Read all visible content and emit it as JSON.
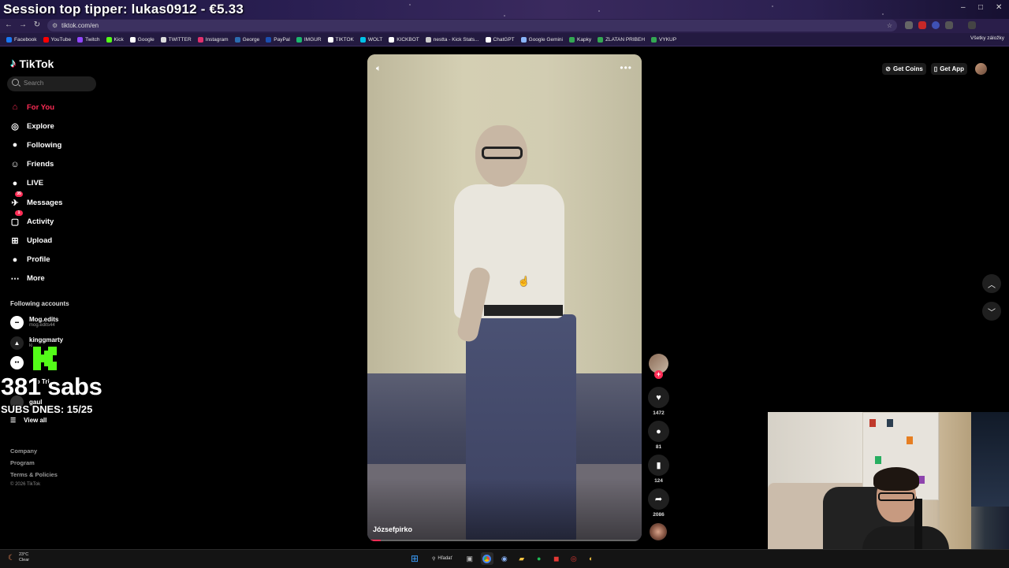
{
  "overlay": {
    "session_tipper": "Session top tipper: lukas0912 - €5.33",
    "subs_count": "381 sabs",
    "subs_goal": "SUBS DNES: 15/25"
  },
  "browser": {
    "url": "tiktok.com/en",
    "window_controls": [
      "–",
      "□",
      "✕"
    ],
    "bookmarks": [
      {
        "label": "Facebook",
        "color": "#1877f2"
      },
      {
        "label": "YouTube",
        "color": "#ff0000"
      },
      {
        "label": "Twitch",
        "color": "#9146ff"
      },
      {
        "label": "Kick",
        "color": "#53fc18"
      },
      {
        "label": "Google",
        "color": "#ffffff"
      },
      {
        "label": "TWITTER",
        "color": "#dddddd"
      },
      {
        "label": "Instagram",
        "color": "#e1306c"
      },
      {
        "label": "George",
        "color": "#2b6cb0"
      },
      {
        "label": "PayPal",
        "color": "#1b4fb0"
      },
      {
        "label": "IMGUR",
        "color": "#1bb76e"
      },
      {
        "label": "TIKTOK",
        "color": "#ffffff"
      },
      {
        "label": "WOLT",
        "color": "#00c2e8"
      },
      {
        "label": "KICKBOT",
        "color": "#ffffff"
      },
      {
        "label": "nestta - Kick Stats...",
        "color": "#cccccc"
      },
      {
        "label": "ChatGPT",
        "color": "#ffffff"
      },
      {
        "label": "Google Gemini",
        "color": "#8ab4f8"
      },
      {
        "label": "Kapky",
        "color": "#34a853"
      },
      {
        "label": "ZLATAN PRIBEH",
        "color": "#34a853"
      },
      {
        "label": "VYKUP",
        "color": "#34a853"
      }
    ],
    "other_bookmarks": "Všetky záložky"
  },
  "sidebar": {
    "logo": "TikTok",
    "search_placeholder": "Search",
    "nav": [
      {
        "label": "For You",
        "icon": "home-icon",
        "glyph": "⌂",
        "active": true
      },
      {
        "label": "Explore",
        "icon": "compass-icon",
        "glyph": "◎"
      },
      {
        "label": "Following",
        "icon": "following-icon",
        "glyph": "●"
      },
      {
        "label": "Friends",
        "icon": "friends-icon",
        "glyph": "☺"
      },
      {
        "label": "LIVE",
        "icon": "live-icon",
        "glyph": "●"
      },
      {
        "label": "Messages",
        "icon": "messages-icon",
        "glyph": "✈",
        "badge": "35"
      },
      {
        "label": "Activity",
        "icon": "activity-icon",
        "glyph": "▢",
        "badge": "1"
      },
      {
        "label": "Upload",
        "icon": "upload-icon",
        "glyph": "⊞"
      },
      {
        "label": "Profile",
        "icon": "profile-icon",
        "glyph": "●"
      },
      {
        "label": "More",
        "icon": "more-icon",
        "glyph": "⋯"
      }
    ],
    "following_title": "Following accounts",
    "accounts": [
      {
        "name": "Mog.edits",
        "handle": "mog.edits44"
      },
      {
        "name": "kinggmarty",
        "handle": "ki"
      },
      {
        "name": "",
        "handle": ""
      },
      {
        "name": "Do Tri",
        "handle": ""
      },
      {
        "name": "gaul",
        "handle": ""
      }
    ],
    "view_all": "View all",
    "footer": [
      "Company",
      "Program",
      "Terms & Policies"
    ],
    "copyright": "© 2026 TikTok"
  },
  "video": {
    "author": "Józsefpirko",
    "progress_fraction": 0.05
  },
  "actions": {
    "likes": "1472",
    "comments": "81",
    "saves": "124",
    "shares": "2086"
  },
  "header_right": {
    "get_coins": "Get Coins",
    "get_app": "Get App"
  },
  "taskbar": {
    "temperature": "23°C",
    "weather": "Clear",
    "search": "Hľadať"
  },
  "colors": {
    "accent": "#fe2c55",
    "kick_green": "#53fc18"
  }
}
